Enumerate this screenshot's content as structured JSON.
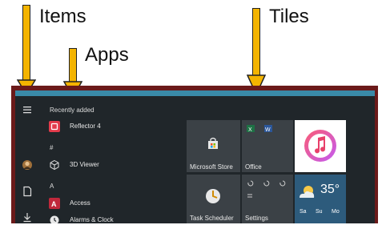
{
  "annotations": {
    "items_label": "Items",
    "apps_label": "Apps",
    "tiles_label": "Tiles",
    "arrow_color": "#f4b400"
  },
  "start_menu": {
    "accent_color": "#3a8aa8",
    "frame_color": "#6b1a1a",
    "background": "#20262a",
    "rail_icons": [
      "hamburger-icon",
      "user-avatar",
      "document-icon",
      "download-icon"
    ],
    "recently_added_header": "Recently added",
    "section_hash": "#",
    "section_a": "A",
    "apps": [
      {
        "name": "Reflector 4",
        "icon": "reflector-icon",
        "color": "#e23b4b"
      },
      {
        "name": "3D Viewer",
        "icon": "cube-icon"
      },
      {
        "name": "Access",
        "icon": "access-icon",
        "color": "#c0283b"
      },
      {
        "name": "Alarms & Clock",
        "icon": "clock-icon"
      }
    ],
    "tiles": [
      {
        "label": "Microsoft Store",
        "icon": "store-icon"
      },
      {
        "label": "Office",
        "icon": "office-icon"
      },
      {
        "label": "",
        "icon": "itunes-icon"
      },
      {
        "label": "Task Scheduler",
        "icon": "task-scheduler-icon"
      },
      {
        "label": "Settings",
        "icon": "settings-icon"
      },
      {
        "label": "35°",
        "icon": "weather-icon"
      }
    ],
    "weather_days": [
      "Sa",
      "Su",
      "Mo"
    ]
  }
}
